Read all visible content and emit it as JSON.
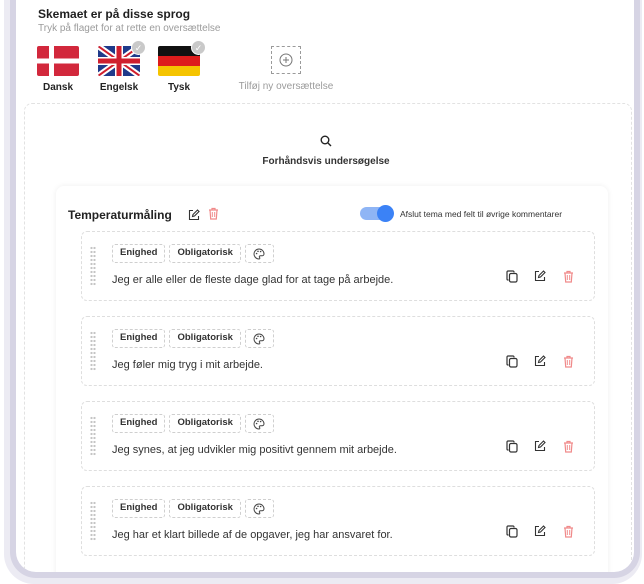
{
  "languages": {
    "title": "Skemaet er på disse sprog",
    "subtitle": "Tryk på flaget for at rette en oversættelse",
    "items": [
      {
        "label": "Dansk",
        "checked": false
      },
      {
        "label": "Engelsk",
        "checked": true
      },
      {
        "label": "Tysk",
        "checked": true
      }
    ],
    "add_label": "Tilføj ny oversættelse"
  },
  "preview": {
    "label": "Forhåndsvis undersøgelse"
  },
  "theme": {
    "title": "Temperaturmåling",
    "toggle_label": "Afslut tema med felt til øvrige kommentarer",
    "toggle_on": true,
    "questions": [
      {
        "tags": [
          "Enighed",
          "Obligatorisk"
        ],
        "text": "Jeg er alle eller de fleste dage glad for at tage på arbejde."
      },
      {
        "tags": [
          "Enighed",
          "Obligatorisk"
        ],
        "text": "Jeg føler mig tryg i mit arbejde."
      },
      {
        "tags": [
          "Enighed",
          "Obligatorisk"
        ],
        "text": "Jeg synes, at jeg udvikler mig positivt gennem mit arbejde."
      },
      {
        "tags": [
          "Enighed",
          "Obligatorisk"
        ],
        "text": "Jeg har et klart billede af de opgaver, jeg har ansvaret for."
      }
    ]
  },
  "colors": {
    "accent": "#3b82f6",
    "delete": "#f08a8a",
    "muted_text": "#9b9b9b"
  }
}
